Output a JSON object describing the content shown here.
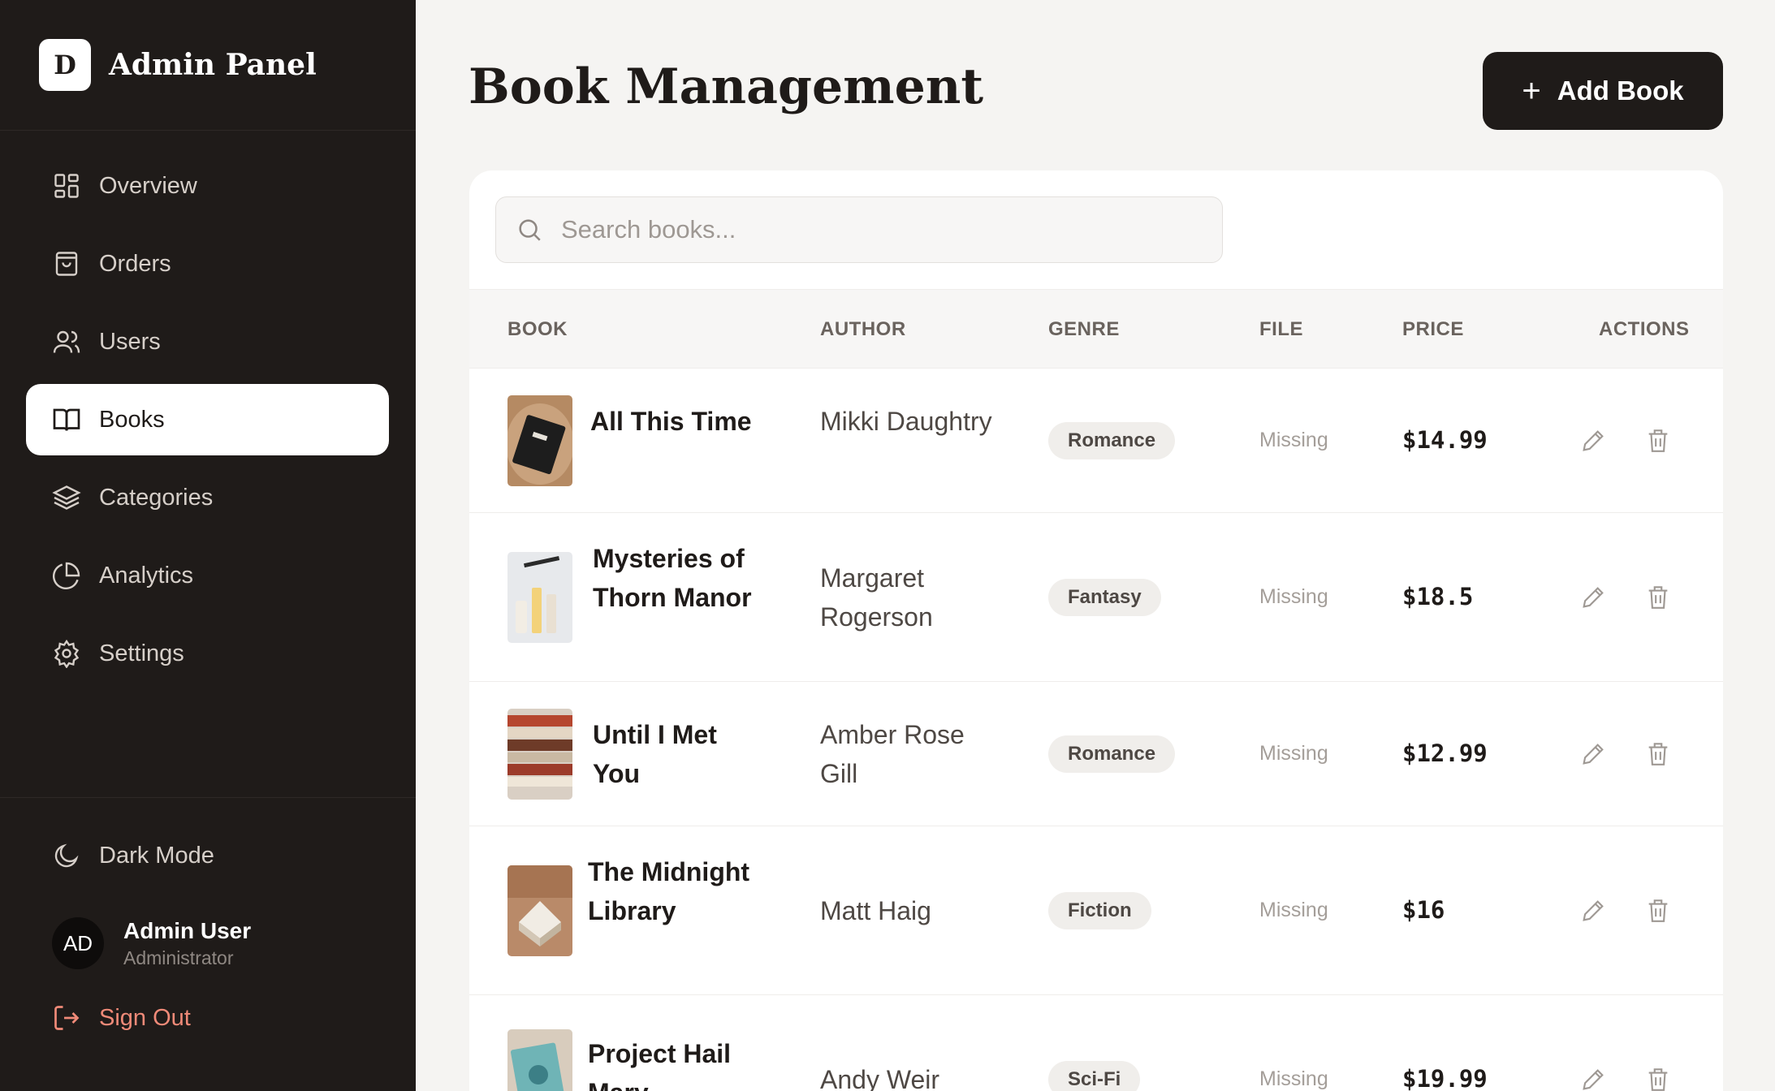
{
  "brand": {
    "logo_letter": "D",
    "title": "Admin Panel"
  },
  "nav": [
    {
      "label": "Overview",
      "icon": "grid-icon",
      "active": false
    },
    {
      "label": "Orders",
      "icon": "shopping-bag-icon",
      "active": false
    },
    {
      "label": "Users",
      "icon": "users-icon",
      "active": false
    },
    {
      "label": "Books",
      "icon": "book-open-icon",
      "active": true
    },
    {
      "label": "Categories",
      "icon": "layers-icon",
      "active": false
    },
    {
      "label": "Analytics",
      "icon": "pie-chart-icon",
      "active": false
    },
    {
      "label": "Settings",
      "icon": "gear-icon",
      "active": false
    }
  ],
  "dark_mode": {
    "label": "Dark Mode",
    "icon": "moon-icon"
  },
  "user": {
    "initials": "AD",
    "name": "Admin User",
    "role": "Administrator"
  },
  "sign_out": {
    "label": "Sign Out",
    "icon": "log-out-icon"
  },
  "header": {
    "title": "Book Management",
    "add_label": "Add Book"
  },
  "search": {
    "placeholder": "Search books..."
  },
  "table": {
    "columns": [
      "BOOK",
      "AUTHOR",
      "GENRE",
      "FILE",
      "PRICE",
      "ACTIONS"
    ],
    "rows": [
      {
        "title": "All This Time",
        "author": "Mikki Daughtry",
        "genre": "Romance",
        "file": "Missing",
        "price": "$14.99"
      },
      {
        "title": "Mysteries of Thorn Manor",
        "author": "Margaret Rogerson",
        "genre": "Fantasy",
        "file": "Missing",
        "price": "$18.5"
      },
      {
        "title": "Until I Met You",
        "author": "Amber Rose Gill",
        "genre": "Romance",
        "file": "Missing",
        "price": "$12.99"
      },
      {
        "title": "The Midnight Library",
        "author": "Matt Haig",
        "genre": "Fiction",
        "file": "Missing",
        "price": "$16"
      },
      {
        "title": "Project Hail Mary",
        "author": "Andy Weir",
        "genre": "Sci-Fi",
        "file": "Missing",
        "price": "$19.99"
      }
    ]
  },
  "colors": {
    "sidebar_bg": "#1f1b19",
    "accent": "#1f1b19",
    "sign_out": "#f08a78",
    "page_bg": "#f5f4f2"
  }
}
